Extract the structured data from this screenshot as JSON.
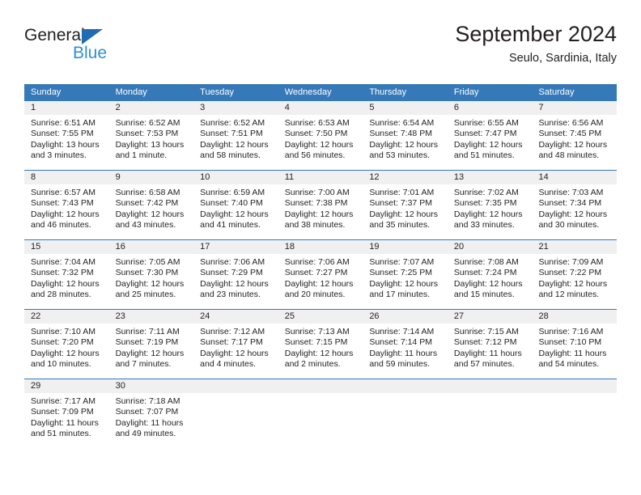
{
  "brand": {
    "name_dark": "General",
    "name_blue": "Blue",
    "color_dark": "#231f20",
    "color_blue": "#2e8fd6",
    "triangle_color": "#1f6cb0"
  },
  "header": {
    "title": "September 2024",
    "subtitle": "Seulo, Sardinia, Italy"
  },
  "theme": {
    "header_blue": "#3679b8",
    "daynum_gray": "#f0f0f0",
    "text": "#231f20"
  },
  "daynames": [
    "Sunday",
    "Monday",
    "Tuesday",
    "Wednesday",
    "Thursday",
    "Friday",
    "Saturday"
  ],
  "weeks": [
    {
      "cells": [
        {
          "day": "1",
          "sunrise": "Sunrise: 6:51 AM",
          "sunset": "Sunset: 7:55 PM",
          "daylight1": "Daylight: 13 hours",
          "daylight2": "and 3 minutes."
        },
        {
          "day": "2",
          "sunrise": "Sunrise: 6:52 AM",
          "sunset": "Sunset: 7:53 PM",
          "daylight1": "Daylight: 13 hours",
          "daylight2": "and 1 minute."
        },
        {
          "day": "3",
          "sunrise": "Sunrise: 6:52 AM",
          "sunset": "Sunset: 7:51 PM",
          "daylight1": "Daylight: 12 hours",
          "daylight2": "and 58 minutes."
        },
        {
          "day": "4",
          "sunrise": "Sunrise: 6:53 AM",
          "sunset": "Sunset: 7:50 PM",
          "daylight1": "Daylight: 12 hours",
          "daylight2": "and 56 minutes."
        },
        {
          "day": "5",
          "sunrise": "Sunrise: 6:54 AM",
          "sunset": "Sunset: 7:48 PM",
          "daylight1": "Daylight: 12 hours",
          "daylight2": "and 53 minutes."
        },
        {
          "day": "6",
          "sunrise": "Sunrise: 6:55 AM",
          "sunset": "Sunset: 7:47 PM",
          "daylight1": "Daylight: 12 hours",
          "daylight2": "and 51 minutes."
        },
        {
          "day": "7",
          "sunrise": "Sunrise: 6:56 AM",
          "sunset": "Sunset: 7:45 PM",
          "daylight1": "Daylight: 12 hours",
          "daylight2": "and 48 minutes."
        }
      ]
    },
    {
      "cells": [
        {
          "day": "8",
          "sunrise": "Sunrise: 6:57 AM",
          "sunset": "Sunset: 7:43 PM",
          "daylight1": "Daylight: 12 hours",
          "daylight2": "and 46 minutes."
        },
        {
          "day": "9",
          "sunrise": "Sunrise: 6:58 AM",
          "sunset": "Sunset: 7:42 PM",
          "daylight1": "Daylight: 12 hours",
          "daylight2": "and 43 minutes."
        },
        {
          "day": "10",
          "sunrise": "Sunrise: 6:59 AM",
          "sunset": "Sunset: 7:40 PM",
          "daylight1": "Daylight: 12 hours",
          "daylight2": "and 41 minutes."
        },
        {
          "day": "11",
          "sunrise": "Sunrise: 7:00 AM",
          "sunset": "Sunset: 7:38 PM",
          "daylight1": "Daylight: 12 hours",
          "daylight2": "and 38 minutes."
        },
        {
          "day": "12",
          "sunrise": "Sunrise: 7:01 AM",
          "sunset": "Sunset: 7:37 PM",
          "daylight1": "Daylight: 12 hours",
          "daylight2": "and 35 minutes."
        },
        {
          "day": "13",
          "sunrise": "Sunrise: 7:02 AM",
          "sunset": "Sunset: 7:35 PM",
          "daylight1": "Daylight: 12 hours",
          "daylight2": "and 33 minutes."
        },
        {
          "day": "14",
          "sunrise": "Sunrise: 7:03 AM",
          "sunset": "Sunset: 7:34 PM",
          "daylight1": "Daylight: 12 hours",
          "daylight2": "and 30 minutes."
        }
      ]
    },
    {
      "cells": [
        {
          "day": "15",
          "sunrise": "Sunrise: 7:04 AM",
          "sunset": "Sunset: 7:32 PM",
          "daylight1": "Daylight: 12 hours",
          "daylight2": "and 28 minutes."
        },
        {
          "day": "16",
          "sunrise": "Sunrise: 7:05 AM",
          "sunset": "Sunset: 7:30 PM",
          "daylight1": "Daylight: 12 hours",
          "daylight2": "and 25 minutes."
        },
        {
          "day": "17",
          "sunrise": "Sunrise: 7:06 AM",
          "sunset": "Sunset: 7:29 PM",
          "daylight1": "Daylight: 12 hours",
          "daylight2": "and 23 minutes."
        },
        {
          "day": "18",
          "sunrise": "Sunrise: 7:06 AM",
          "sunset": "Sunset: 7:27 PM",
          "daylight1": "Daylight: 12 hours",
          "daylight2": "and 20 minutes."
        },
        {
          "day": "19",
          "sunrise": "Sunrise: 7:07 AM",
          "sunset": "Sunset: 7:25 PM",
          "daylight1": "Daylight: 12 hours",
          "daylight2": "and 17 minutes."
        },
        {
          "day": "20",
          "sunrise": "Sunrise: 7:08 AM",
          "sunset": "Sunset: 7:24 PM",
          "daylight1": "Daylight: 12 hours",
          "daylight2": "and 15 minutes."
        },
        {
          "day": "21",
          "sunrise": "Sunrise: 7:09 AM",
          "sunset": "Sunset: 7:22 PM",
          "daylight1": "Daylight: 12 hours",
          "daylight2": "and 12 minutes."
        }
      ]
    },
    {
      "cells": [
        {
          "day": "22",
          "sunrise": "Sunrise: 7:10 AM",
          "sunset": "Sunset: 7:20 PM",
          "daylight1": "Daylight: 12 hours",
          "daylight2": "and 10 minutes."
        },
        {
          "day": "23",
          "sunrise": "Sunrise: 7:11 AM",
          "sunset": "Sunset: 7:19 PM",
          "daylight1": "Daylight: 12 hours",
          "daylight2": "and 7 minutes."
        },
        {
          "day": "24",
          "sunrise": "Sunrise: 7:12 AM",
          "sunset": "Sunset: 7:17 PM",
          "daylight1": "Daylight: 12 hours",
          "daylight2": "and 4 minutes."
        },
        {
          "day": "25",
          "sunrise": "Sunrise: 7:13 AM",
          "sunset": "Sunset: 7:15 PM",
          "daylight1": "Daylight: 12 hours",
          "daylight2": "and 2 minutes."
        },
        {
          "day": "26",
          "sunrise": "Sunrise: 7:14 AM",
          "sunset": "Sunset: 7:14 PM",
          "daylight1": "Daylight: 11 hours",
          "daylight2": "and 59 minutes."
        },
        {
          "day": "27",
          "sunrise": "Sunrise: 7:15 AM",
          "sunset": "Sunset: 7:12 PM",
          "daylight1": "Daylight: 11 hours",
          "daylight2": "and 57 minutes."
        },
        {
          "day": "28",
          "sunrise": "Sunrise: 7:16 AM",
          "sunset": "Sunset: 7:10 PM",
          "daylight1": "Daylight: 11 hours",
          "daylight2": "and 54 minutes."
        }
      ]
    },
    {
      "cells": [
        {
          "day": "29",
          "sunrise": "Sunrise: 7:17 AM",
          "sunset": "Sunset: 7:09 PM",
          "daylight1": "Daylight: 11 hours",
          "daylight2": "and 51 minutes."
        },
        {
          "day": "30",
          "sunrise": "Sunrise: 7:18 AM",
          "sunset": "Sunset: 7:07 PM",
          "daylight1": "Daylight: 11 hours",
          "daylight2": "and 49 minutes."
        },
        {
          "day": "",
          "sunrise": "",
          "sunset": "",
          "daylight1": "",
          "daylight2": ""
        },
        {
          "day": "",
          "sunrise": "",
          "sunset": "",
          "daylight1": "",
          "daylight2": ""
        },
        {
          "day": "",
          "sunrise": "",
          "sunset": "",
          "daylight1": "",
          "daylight2": ""
        },
        {
          "day": "",
          "sunrise": "",
          "sunset": "",
          "daylight1": "",
          "daylight2": ""
        },
        {
          "day": "",
          "sunrise": "",
          "sunset": "",
          "daylight1": "",
          "daylight2": ""
        }
      ]
    }
  ]
}
